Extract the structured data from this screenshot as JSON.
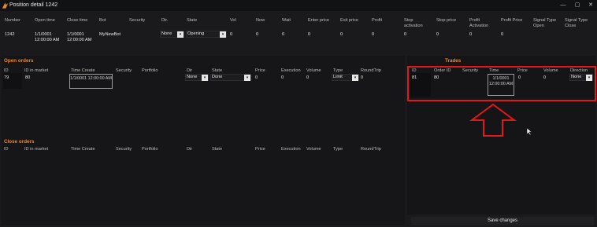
{
  "window": {
    "title": "Position detail  1242",
    "minimize": "—",
    "maximize": "▢",
    "close": "✕"
  },
  "position": {
    "headers": [
      "Number",
      "Open time",
      "Close time",
      "Bot",
      "Security",
      "Dir.",
      "State",
      "Vol",
      "Now",
      "Wait",
      "Enter price",
      "Exit price",
      "Profit",
      "Stop activation",
      "Stop price",
      "Profit Activation",
      "Profit Price",
      "Signal Type Open",
      "Signal Type Close"
    ],
    "row": {
      "number": "1242",
      "open_time": "1/1/0001 12:00:00 AM",
      "close_time": "1/1/0001 12:00:00 AM",
      "bot": "MyNewBot",
      "dir": "None",
      "state": "Opening",
      "vol": "0",
      "now": "0",
      "wait": "0",
      "enter_price": "0",
      "exit_price": "0",
      "profit": "0",
      "stop_activation": "0",
      "stop_price": "0",
      "profit_activation": "0",
      "profit_price": "0"
    }
  },
  "open_orders": {
    "title": "Open orders",
    "headers": [
      "ID",
      "ID in market",
      "Time Create",
      "Security",
      "Portfolio",
      "Dir",
      "State",
      "Price",
      "Execution",
      "Volume",
      "Type",
      "RoundTrip"
    ],
    "row": {
      "id": "79",
      "id_market": "80",
      "time": "1/1/0001 12:00:00 AM",
      "dir": "None",
      "state": "Done",
      "price": "0",
      "execution": "0",
      "volume": "0",
      "type": "Limit",
      "roundtrip": "0"
    }
  },
  "trades": {
    "title": "Trades",
    "headers": [
      "ID",
      "Order ID",
      "Security",
      "Time",
      "Price",
      "Volume",
      "Direction"
    ],
    "row": {
      "id": "81",
      "order_id": "80",
      "time": "1/1/0001 12:00:00 AM",
      "price": "0",
      "volume": "0",
      "direction": "None"
    }
  },
  "close_orders": {
    "title": "Close orders",
    "headers": [
      "ID",
      "ID in market",
      "Time Create",
      "Security",
      "Portfolio",
      "Dir",
      "State",
      "Price",
      "Execution",
      "Volume",
      "Type",
      "RoundTrip"
    ]
  },
  "save_label": "Save changes",
  "colors": {
    "accent": "#e8872e",
    "highlight": "#e01818"
  }
}
